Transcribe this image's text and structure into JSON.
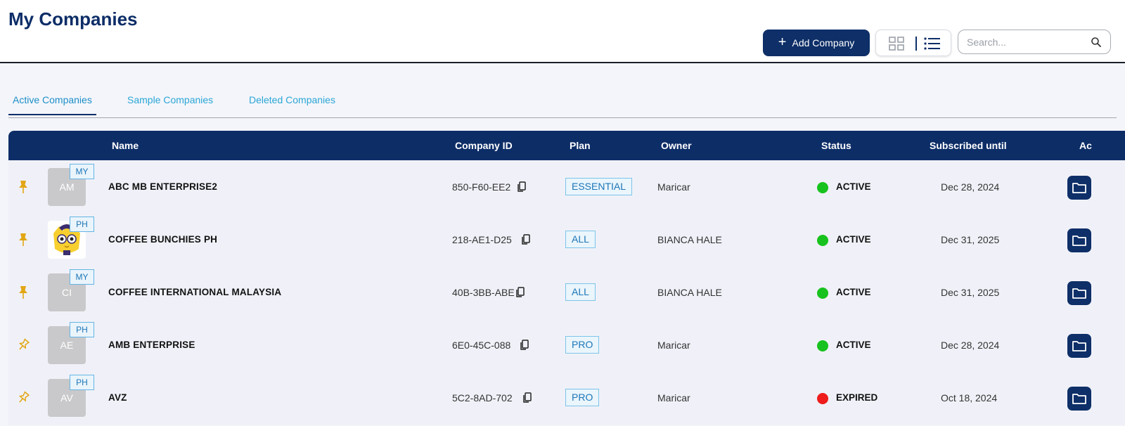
{
  "page": {
    "title": "My Companies"
  },
  "toolbar": {
    "add_label": "Add Company",
    "search_placeholder": "Search..."
  },
  "tabs": [
    {
      "label": "Active Companies",
      "active": true
    },
    {
      "label": "Sample Companies",
      "active": false
    },
    {
      "label": "Deleted Companies",
      "active": false
    }
  ],
  "table": {
    "headers": [
      "Name",
      "Company ID",
      "Plan",
      "Owner",
      "Status",
      "Subscribed until",
      "Ac"
    ],
    "rows": [
      {
        "pinned": true,
        "avatar": "AM",
        "avatar_image": false,
        "country": "MY",
        "name": "ABC MB ENTERPRISE2",
        "company_id": "850-F60-EE2",
        "plan": "ESSENTIAL",
        "owner": "Maricar",
        "status": "ACTIVE",
        "status_color": "#18c21e",
        "subscribed_until": "Dec 28, 2024"
      },
      {
        "pinned": true,
        "avatar": "",
        "avatar_image": true,
        "country": "PH",
        "name": "COFFEE BUNCHIES PH",
        "company_id": "218-AE1-D25",
        "plan": "ALL",
        "owner": "BIANCA HALE",
        "status": "ACTIVE",
        "status_color": "#18c21e",
        "subscribed_until": "Dec 31, 2025"
      },
      {
        "pinned": true,
        "avatar": "CI",
        "avatar_image": false,
        "country": "MY",
        "name": "COFFEE INTERNATIONAL MALAYSIA",
        "company_id": "40B-3BB-ABE",
        "plan": "ALL",
        "owner": "BIANCA HALE",
        "status": "ACTIVE",
        "status_color": "#18c21e",
        "subscribed_until": "Dec 31, 2025"
      },
      {
        "pinned": false,
        "avatar": "AE",
        "avatar_image": false,
        "country": "PH",
        "name": "AMB ENTERPRISE",
        "company_id": "6E0-45C-088",
        "plan": "PRO",
        "owner": "Maricar",
        "status": "ACTIVE",
        "status_color": "#18c21e",
        "subscribed_until": "Dec 28, 2024"
      },
      {
        "pinned": false,
        "avatar": "AV",
        "avatar_image": false,
        "country": "PH",
        "name": "AVZ",
        "company_id": "5C2-8AD-702",
        "plan": "PRO",
        "owner": "Maricar",
        "status": "EXPIRED",
        "status_color": "#ee1c1c",
        "subscribed_until": "Oct 18, 2024"
      }
    ]
  },
  "colors": {
    "brand": "#0d2d67",
    "accent": "#2aa6d6",
    "pin": "#e2a614"
  },
  "icons": {
    "add": "plus-icon",
    "grid": "grid-view-icon",
    "list": "list-view-icon",
    "search": "search-icon",
    "pin": "pin-icon",
    "copy": "copy-icon",
    "folder": "folder-icon"
  }
}
